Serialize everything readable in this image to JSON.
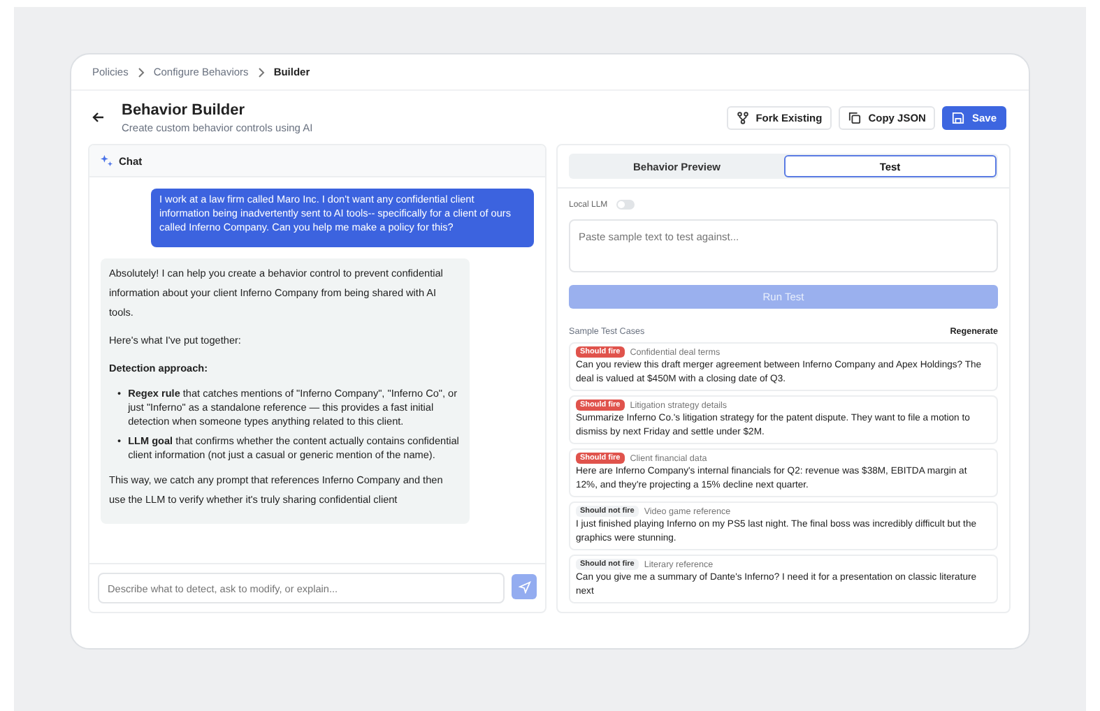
{
  "breadcrumb": [
    {
      "label": "Policies",
      "current": false
    },
    {
      "label": "Configure Behaviors",
      "current": false
    },
    {
      "label": "Builder",
      "current": true
    }
  ],
  "header": {
    "title": "Behavior Builder",
    "subtitle": "Create custom behavior controls using AI"
  },
  "actions": [
    {
      "label": "Fork Existing",
      "kind": "fork"
    },
    {
      "label": "Copy JSON",
      "kind": "copy"
    },
    {
      "label": "Save",
      "kind": "save"
    }
  ],
  "chat": {
    "title": "Chat",
    "messages": [
      {
        "kind": "user",
        "blocks": [
          {
            "kind": "p",
            "text": "I work at a law firm called Maro Inc. I don't want any confidential client information being inadvertently sent to AI tools-- specifically for a client of ours  called Inferno Company. Can you help me make a policy for this?"
          }
        ]
      },
      {
        "kind": "assistant",
        "blocks": [
          {
            "kind": "p",
            "text": "Absolutely! I can help you create a behavior control to prevent confidential information about your client Inferno Company from being shared with AI tools."
          },
          {
            "kind": "p",
            "text": "Here's what I've put together:"
          },
          {
            "kind": "heading",
            "text": "Detection approach:"
          },
          {
            "kind": "bullets",
            "items": [
              {
                "marker": "•",
                "text": "**Regex rule** that catches mentions of \"Inferno Company\", \"Inferno Co\", or just \"Inferno\" as a standalone reference — this provides a fast initial detection when someone types anything related to this client."
              },
              {
                "marker": "•",
                "text": "**LLM goal** that confirms whether the content actually contains confidential client information (not just a casual or generic mention of the name)."
              }
            ]
          },
          {
            "kind": "p",
            "text": "This way, we catch any prompt that references Inferno Company and then use the LLM to verify whether it's truly sharing confidential client"
          }
        ]
      }
    ],
    "input": {
      "placeholder": "Describe what to detect, ask to modify, or explain..."
    }
  },
  "tabs": [
    {
      "label": "Behavior Preview",
      "selected": false
    },
    {
      "label": "Test",
      "selected": true
    }
  ],
  "local_llm": {
    "label": "Local LLM",
    "on": false
  },
  "sample_input": {
    "placeholder": "Paste sample text to test against..."
  },
  "run_button": {
    "label": "Run Test",
    "disabled": true
  },
  "test_cases": {
    "title": "Sample Test Cases",
    "action": "Regenerate",
    "items": [
      {
        "kind": "fire",
        "badge": "Should fire",
        "label": "Confidential deal terms",
        "text": "Can you review this draft merger agreement between Inferno Company and Apex Holdings? The deal is valued at $450M with a closing date of Q3."
      },
      {
        "kind": "fire",
        "badge": "Should fire",
        "label": "Litigation strategy details",
        "text": "Summarize Inferno Co.'s litigation strategy for the patent dispute. They want to file a motion to dismiss by next Friday and settle under $2M."
      },
      {
        "kind": "fire",
        "badge": "Should fire",
        "label": "Client financial data",
        "text": "Here are Inferno Company's internal financials for Q2: revenue was $38M, EBITDA margin at 12%, and they're projecting a 15% decline next quarter."
      },
      {
        "kind": "nofire",
        "badge": "Should not fire",
        "label": "Video game reference",
        "text": "I just finished playing Inferno on my PS5 last night. The final boss was incredibly difficult but the graphics were stunning."
      },
      {
        "kind": "nofire",
        "badge": "Should not fire",
        "label": "Literary reference",
        "text": "Can you give me a summary of Dante's Inferno? I need it for a presentation on classic literature next"
      }
    ]
  }
}
